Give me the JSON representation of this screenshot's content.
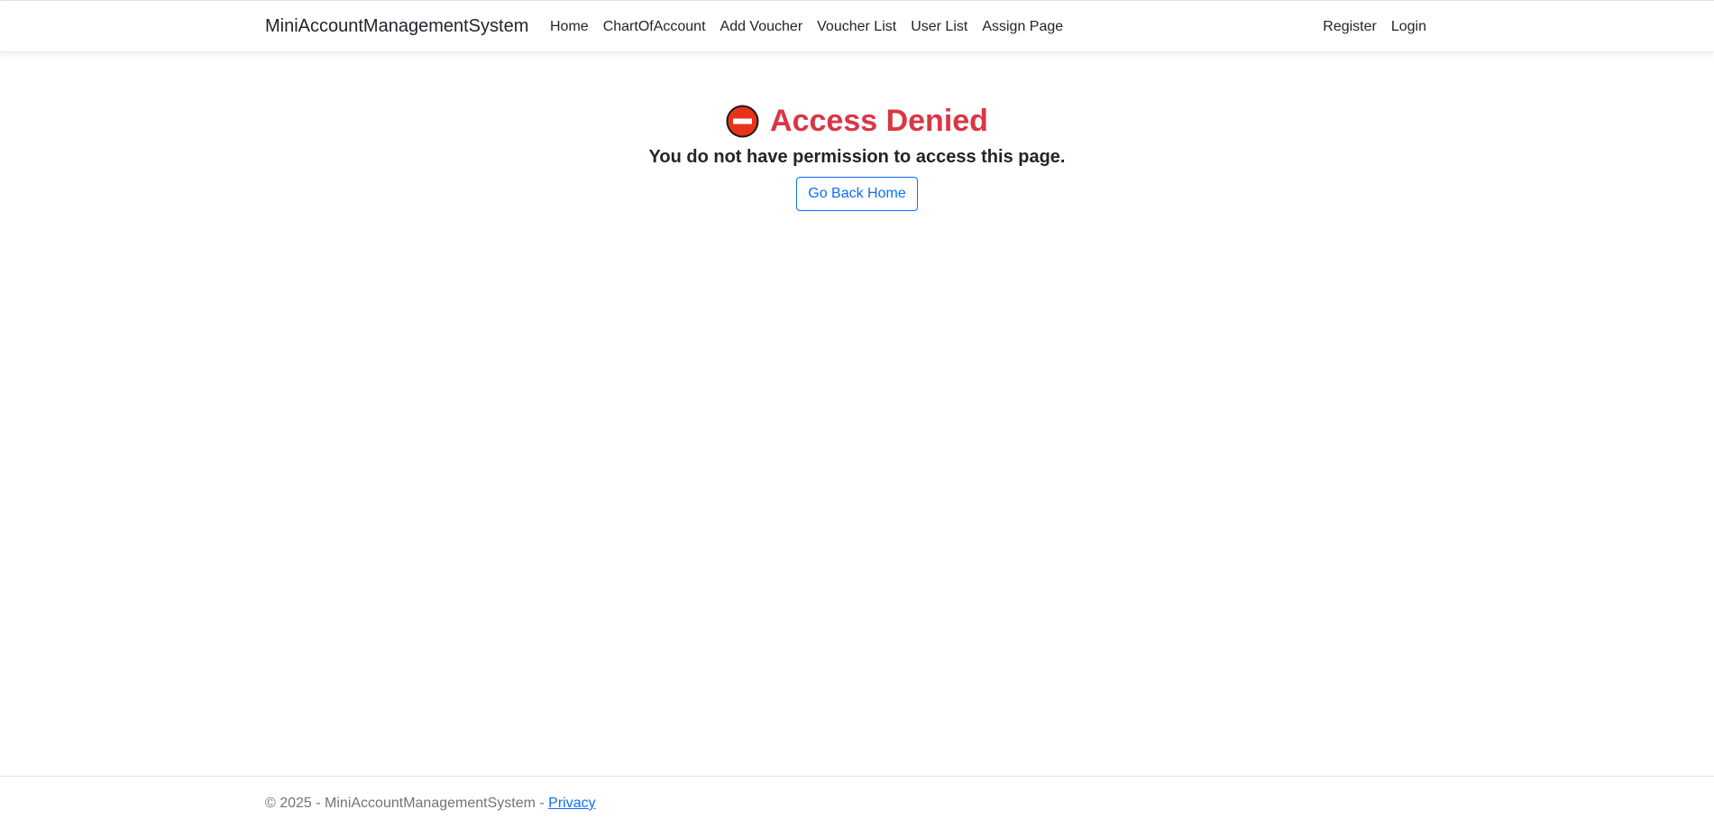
{
  "nav": {
    "brand": "MiniAccountManagementSystem",
    "links": [
      "Home",
      "ChartOfAccount",
      "Add Voucher",
      "Voucher List",
      "User List",
      "Assign Page"
    ],
    "right_links": [
      "Register",
      "Login"
    ]
  },
  "main": {
    "icon": "no-entry-icon",
    "title": "Access Denied",
    "message": "You do not have permission to access this page.",
    "button_label": "Go Back Home"
  },
  "footer": {
    "text": "© 2025 - MiniAccountManagementSystem - ",
    "link": "Privacy"
  },
  "colors": {
    "danger": "#dc3545",
    "primary": "#0d6efd",
    "icon_fill": "#e8331b"
  }
}
